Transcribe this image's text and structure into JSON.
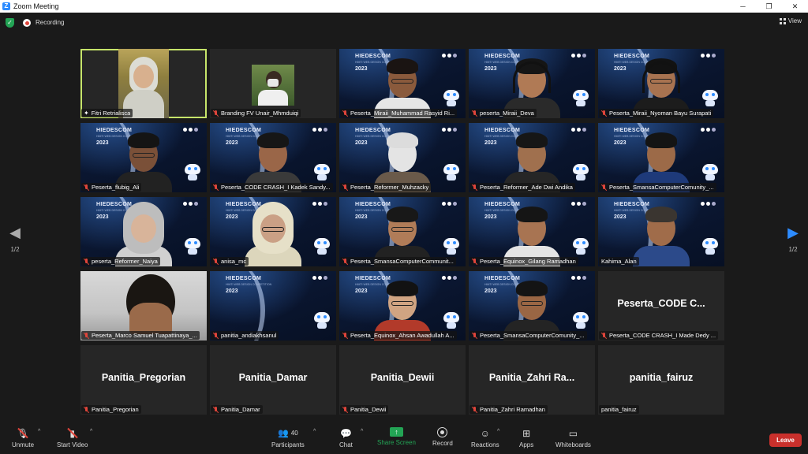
{
  "window": {
    "title": "Zoom Meeting",
    "controls": [
      "─",
      "❐",
      "✕"
    ]
  },
  "top": {
    "recording_label": "Recording",
    "view_label": "View"
  },
  "pager": {
    "left_label": "1/2",
    "right_label": "1/2",
    "left_arrow": "◀",
    "right_arrow": "▶"
  },
  "tiles": [
    {
      "name": "Fitri Retrialisca",
      "kind": "video-real"
    },
    {
      "name": "Branding FV Unair_Mhmduiqi",
      "kind": "video-thumb"
    },
    {
      "name": "Peserta_Miraii_Muhammad Rasyid Ri...",
      "kind": "video-bg"
    },
    {
      "name": "peserta_Miraii_Deva",
      "kind": "video-bg"
    },
    {
      "name": "Peserta_Miraii_Nyoman Bayu Surapati",
      "kind": "video-bg"
    },
    {
      "name": "Peserta_flubig_Ali",
      "kind": "video-bg"
    },
    {
      "name": "Peserta_CODE CRASH_I Kadek Sandy...",
      "kind": "video-bg"
    },
    {
      "name": "Peserta_Reformer_Muhzacky",
      "kind": "video-bg"
    },
    {
      "name": "Peserta_Reformer_Ade Dwi Andika",
      "kind": "video-bg"
    },
    {
      "name": "Peserta_SmansaComputerComunity_...",
      "kind": "video-bg"
    },
    {
      "name": "peserta_Reformer_Naiya",
      "kind": "video-bg"
    },
    {
      "name": "anisa_mc",
      "kind": "video-bg"
    },
    {
      "name": "Peserta_SmansaComputerCommunit...",
      "kind": "video-bg"
    },
    {
      "name": "Peserta_Equinox_Gilang Ramadhan",
      "kind": "video-bg"
    },
    {
      "name": "Kahima_Alan",
      "kind": "video-bg"
    },
    {
      "name": "Peserta_Marco Samuel Tuapattinaya_...",
      "kind": "video-real"
    },
    {
      "name": "panitia_andiakhsanul",
      "kind": "video-bg"
    },
    {
      "name": "Peserta_Equinox_Ahsan Awadullah A...",
      "kind": "video-bg"
    },
    {
      "name": "Peserta_SmansaComputerComunity_...",
      "kind": "video-bg"
    },
    {
      "name": "Peserta_CODE CRASH_I Made Dedy ...",
      "kind": "name-only",
      "display": "Peserta_CODE  C..."
    },
    {
      "name": "Panitia_Pregorian",
      "kind": "name-only",
      "display": "Panitia_Pregorian"
    },
    {
      "name": "Panitia_Damar",
      "kind": "name-only",
      "display": "Panitia_Damar"
    },
    {
      "name": "Panitia_Dewii",
      "kind": "name-only",
      "display": "Panitia_Dewii"
    },
    {
      "name": "Panitia_Zahri Ramadhan",
      "kind": "name-only",
      "display": "Panitia_Zahri  Ra..."
    },
    {
      "name": "panitia_fairuz",
      "kind": "name-only",
      "display": "panitia_fairuz"
    }
  ],
  "background": {
    "brand": "HIEDESCOM",
    "subtitle": "HIMTI WEB DESIGN COMPETITION",
    "year": "2023"
  },
  "toolbar": {
    "unmute": "Unmute",
    "start_video": "Start Video",
    "participants": "Participants",
    "participants_count": "40",
    "chat": "Chat",
    "share_screen": "Share Screen",
    "record": "Record",
    "reactions": "Reactions",
    "apps": "Apps",
    "whiteboards": "Whiteboards",
    "leave": "Leave"
  },
  "colors": {
    "accent": "#2d8cff",
    "active_speaker": "#c6e46a",
    "share": "#23a455",
    "leave": "#c9302c",
    "muted": "#e0453b"
  }
}
